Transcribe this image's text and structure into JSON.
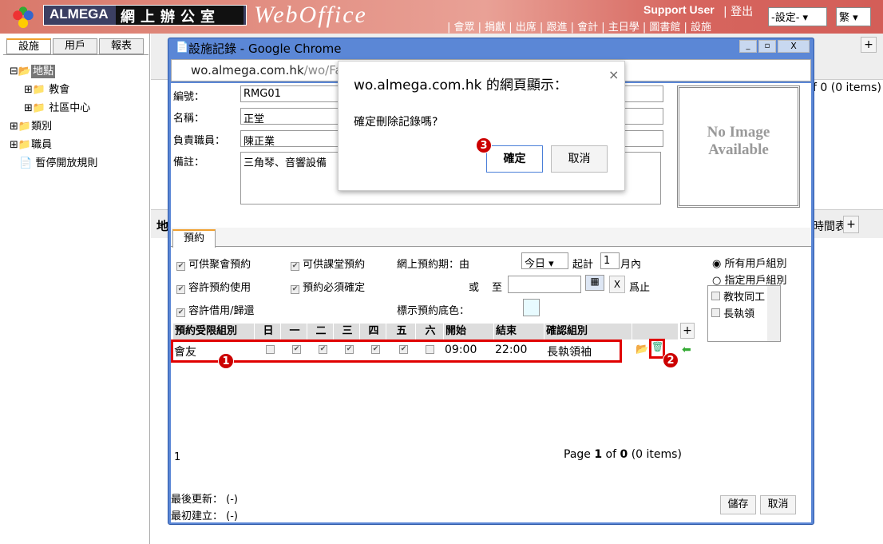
{
  "header": {
    "logo_en": "ALMEGA",
    "logo_cn": "網上辦公室",
    "brand": "WebOffice",
    "user": "Support User",
    "logout": "| 登出",
    "nav": "| 會眾 | 捐獻 | 出席 | 跟進 | 會計 | 主日學 | 圖書館 | 設施",
    "settings_select": "-設定-",
    "lang_select": "繁"
  },
  "sidebar": {
    "tabs": [
      "設施",
      "用戶",
      "報表"
    ],
    "tree": [
      {
        "label": "地點",
        "level": 0,
        "selected": true
      },
      {
        "label": "教會",
        "level": 1
      },
      {
        "label": "社區中心",
        "level": 1
      },
      {
        "label": "類別",
        "level": 0
      },
      {
        "label": "職員",
        "level": 0
      },
      {
        "label": "暫停開放規則",
        "level": 0
      }
    ]
  },
  "background": {
    "paging_suffix": "f 0 (0 items)",
    "label_left": "地",
    "label_right": "時間表",
    "add": "+"
  },
  "popup": {
    "title": "設施記錄 - Google Chrome",
    "url_host": "wo.almega.com.hk",
    "url_path": "/wo/Fa",
    "form": {
      "code_label": "編號：",
      "code": "RMG01",
      "name_label": "名稱：",
      "name": "正堂",
      "staff_label": "負責職員：",
      "staff": "陳正業",
      "remark_label": "備註：",
      "remark": "三角琴、音響設備"
    },
    "no_image": "No Image Available",
    "tab": "預約",
    "options": {
      "c1": "可供聚會預約",
      "c2": "可供課堂預約",
      "c3": "容許預約使用",
      "c4": "預約必須確定",
      "c5": "容許借用/歸還",
      "period_label": "網上預約期：由",
      "period_from": "今日",
      "count_prefix": "起計",
      "count": "1",
      "count_suffix": "月內",
      "or": "或",
      "to": "至",
      "clear": "X",
      "until": "爲止",
      "color_label": "標示預約底色：",
      "r1": "所有用戶組別",
      "r2": "指定用戶組別",
      "groups": [
        "教牧同工",
        "長執領"
      ]
    },
    "table": {
      "headers": [
        "預約受限組別",
        "日",
        "一",
        "二",
        "三",
        "四",
        "五",
        "六",
        "開始",
        "結束",
        "確認組別"
      ],
      "rows": [
        {
          "group": "會友",
          "days": [
            false,
            true,
            true,
            true,
            true,
            true,
            false
          ],
          "start": "09:00",
          "end": "22:00",
          "confirm": "長執領袖"
        }
      ],
      "add": "+"
    },
    "pager": {
      "left": "1",
      "text_pre": "Page ",
      "page": "1",
      "of": " of ",
      "total": "0",
      "items": " (0 items)"
    },
    "last_update_label": "最後更新：",
    "last_update": "(-)",
    "created_label": "最初建立：",
    "created": "(-)",
    "save": "儲存",
    "cancel": "取消"
  },
  "dialog": {
    "title": "wo.almega.com.hk 的網頁顯示：",
    "message": "確定刪除記錄嗎?",
    "ok": "確定",
    "cancel": "取消",
    "close": "×"
  },
  "annotations": [
    "1",
    "2",
    "3"
  ],
  "colors": {
    "header": "#d9786a",
    "chrome_frame": "#5b87d6",
    "highlight": "#e00000"
  }
}
